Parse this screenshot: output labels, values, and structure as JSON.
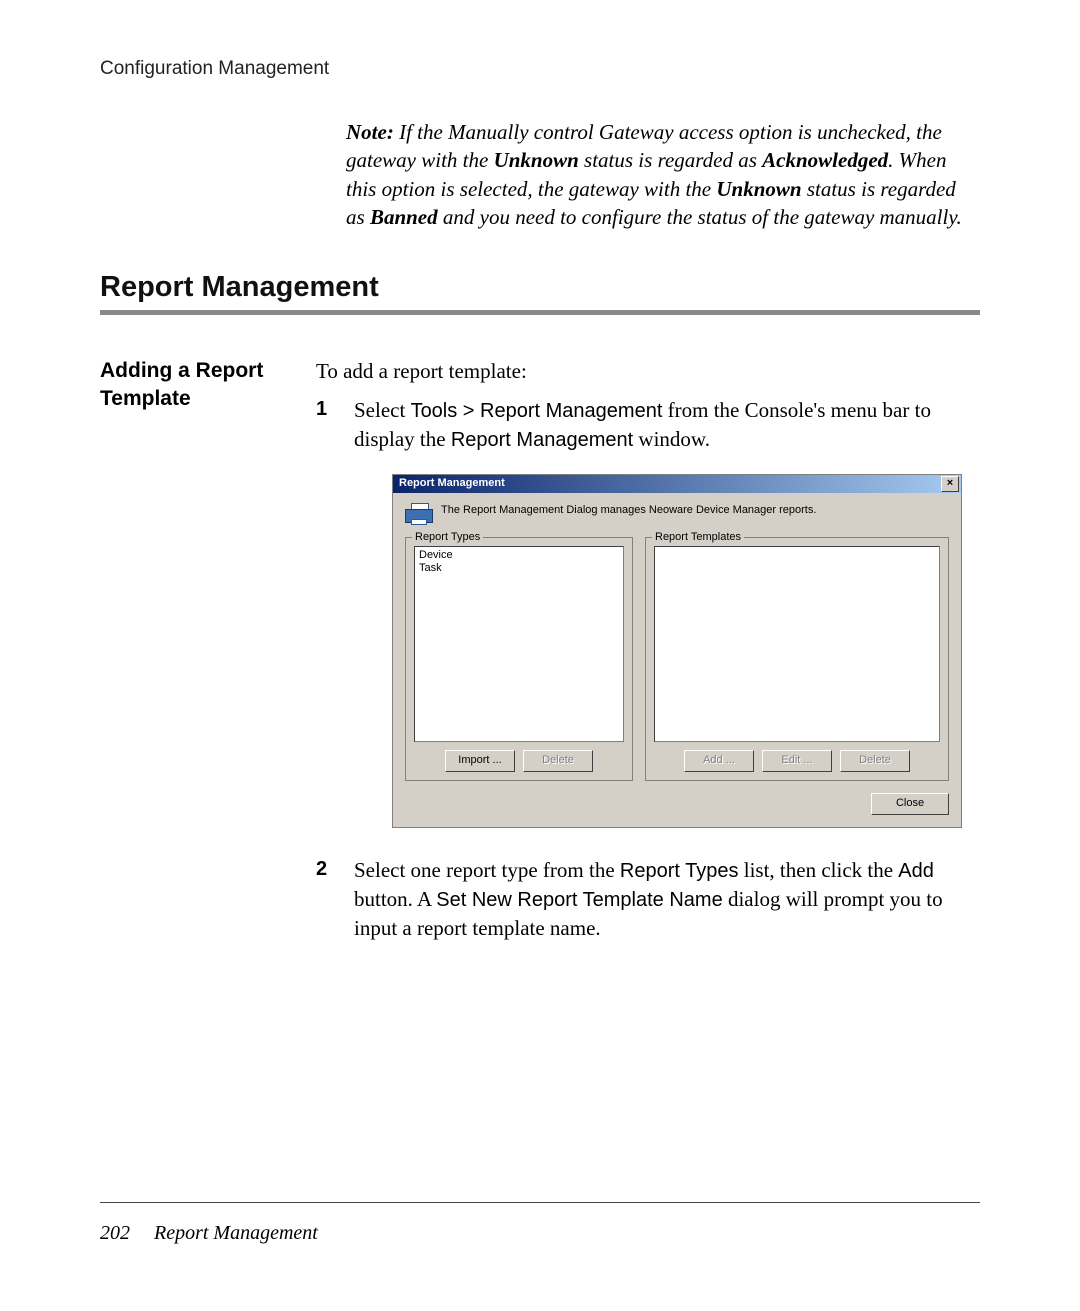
{
  "header": {
    "chapter": "Configuration Management"
  },
  "note": {
    "label": "Note:",
    "phrase_manual": "Manually control Gateway access",
    "seg1": " If the ",
    "seg2": " option is unchecked, the gateway with the ",
    "unknown": "Unknown",
    "seg3": " status is regarded as ",
    "ack": "Acknowledged",
    "seg4": ". When this option is selected, the gateway with the ",
    "seg5": " status is regarded as ",
    "banned": "Banned",
    "seg6": " and you need to configure the status of the gateway manually."
  },
  "section": {
    "title": "Report Management"
  },
  "subsection": {
    "side_label": "Adding a Report Template"
  },
  "intro": "To add a report template:",
  "step1": {
    "pre": "Select ",
    "menu": "Tools > Report Management",
    "mid": " from the Console's menu bar to display the ",
    "win": "Report Management",
    "post": " window."
  },
  "step2": {
    "pre": "Select one report type from the ",
    "list": "Report Types",
    "mid1": " list, then click the ",
    "addbtn": "Add",
    "mid2": " button. A ",
    "dlg": "Set New Report Template Name",
    "post": " dialog will prompt you to input a report template name."
  },
  "dialog": {
    "title": "Report Management",
    "close_x": "×",
    "description": "The Report Management Dialog manages Neoware Device Manager reports.",
    "left_group": "Report Types",
    "right_group": "Report Templates",
    "types": [
      "Device",
      "Task"
    ],
    "btn_import": "Import ...",
    "btn_delete": "Delete",
    "btn_add": "Add ...",
    "btn_edit": "Edit ...",
    "btn_delete2": "Delete",
    "btn_close": "Close"
  },
  "footer": {
    "page": "202",
    "section": "Report Management"
  }
}
